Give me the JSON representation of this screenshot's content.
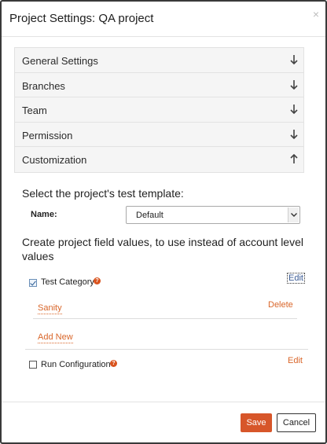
{
  "dialog": {
    "title": "Project Settings: QA project",
    "close_icon": "×"
  },
  "accordion": [
    {
      "label": "General Settings",
      "icon": "arrow-down-icon",
      "expanded": false
    },
    {
      "label": "Branches",
      "icon": "arrow-down-icon",
      "expanded": false
    },
    {
      "label": "Team",
      "icon": "arrow-down-icon",
      "expanded": false
    },
    {
      "label": "Permission",
      "icon": "arrow-down-icon",
      "expanded": false
    },
    {
      "label": "Customization",
      "icon": "arrow-up-icon",
      "expanded": true
    }
  ],
  "customization": {
    "template_heading": "Select the project's test template:",
    "name_label": "Name:",
    "name_value": "Default",
    "fields_heading": "Create project field values, to use instead of account level values",
    "fields": [
      {
        "label": "Test Category",
        "checked": true,
        "edit_label": "Edit",
        "values": [
          {
            "label": "Sanity",
            "delete_label": "Delete"
          }
        ],
        "add_new_label": "Add New"
      },
      {
        "label": "Run Configuration",
        "checked": false,
        "edit_label": "Edit"
      }
    ]
  },
  "footer": {
    "save_label": "Save",
    "cancel_label": "Cancel"
  },
  "colors": {
    "accent": "#d7562a",
    "link_orange": "#d9662a",
    "link_blue": "#3a5b95",
    "help_icon": "#d9531e"
  }
}
